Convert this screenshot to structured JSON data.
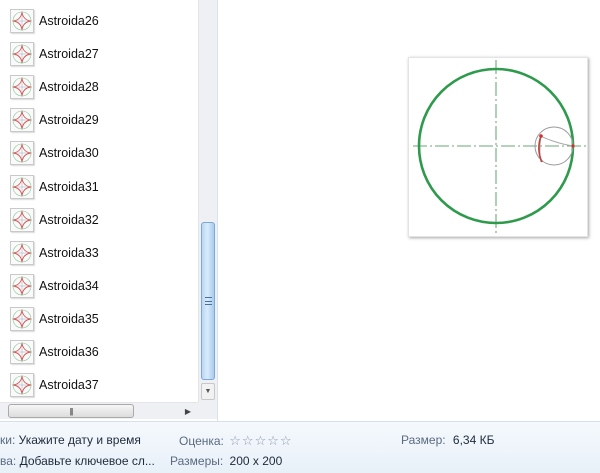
{
  "files": [
    {
      "name": "Astroida26"
    },
    {
      "name": "Astroida27"
    },
    {
      "name": "Astroida28"
    },
    {
      "name": "Astroida29"
    },
    {
      "name": "Astroida30"
    },
    {
      "name": "Astroida31"
    },
    {
      "name": "Astroida32"
    },
    {
      "name": "Astroida33"
    },
    {
      "name": "Astroida34"
    },
    {
      "name": "Astroida35"
    },
    {
      "name": "Astroida36"
    },
    {
      "name": "Astroida37"
    }
  ],
  "details": {
    "date_key": "ки:",
    "date_value": "Укажите дату и время",
    "rating_key": "Оценка:",
    "rating_value": 0,
    "rating_max": 5,
    "size_key": "Размер:",
    "size_value": "6,34 КБ",
    "tags_key": "ва:",
    "tags_value": "Добавьте ключевое сл...",
    "dims_key": "Размеры:",
    "dims_value": "200 x 200"
  },
  "colors": {
    "circle": "#2e9a4c",
    "axis": "#3a8a4a",
    "small_circle": "#9a9a9a",
    "point": "#d0312d"
  },
  "icons": {
    "thumbnail": "astroid-thumbnail-icon",
    "stars": "star-outline-icon"
  }
}
